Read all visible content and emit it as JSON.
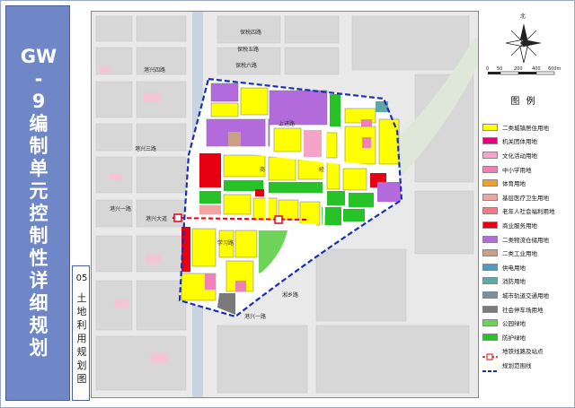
{
  "title": {
    "lines": [
      "GW",
      "-",
      "9",
      "编",
      "制",
      "单",
      "元",
      "控",
      "制",
      "性",
      "详",
      "细",
      "规",
      "划"
    ]
  },
  "sheet": {
    "number": "05",
    "name_chars": [
      "土",
      "地",
      "利",
      "用",
      "规",
      "划",
      "图"
    ]
  },
  "compass": {
    "north_label": "北",
    "scale_ticks": [
      "0",
      "50",
      "200",
      "400",
      "600m"
    ]
  },
  "legend": {
    "title": "图 例",
    "items": [
      {
        "label": "二类城镇居住用地",
        "color": "#ffff00",
        "kind": "fill"
      },
      {
        "label": "机关团体用地",
        "color": "#e6007e",
        "kind": "fill"
      },
      {
        "label": "文化活动用地",
        "color": "#f6a3c8",
        "kind": "fill"
      },
      {
        "label": "中小学用地",
        "color": "#f080b8",
        "kind": "fill"
      },
      {
        "label": "体育用地",
        "color": "#f0a030",
        "kind": "fill"
      },
      {
        "label": "基层医疗卫生用地",
        "color": "#f4a3a3",
        "kind": "fill"
      },
      {
        "label": "老年人社会福利用地",
        "color": "#f27b8a",
        "kind": "fill"
      },
      {
        "label": "商业服务用地",
        "color": "#e60012",
        "kind": "fill"
      },
      {
        "label": "二类物流仓储用地",
        "color": "#b36bdc",
        "kind": "fill"
      },
      {
        "label": "二类工业用地",
        "color": "#c9a088",
        "kind": "fill"
      },
      {
        "label": "供电用地",
        "color": "#4f9bc4",
        "kind": "fill"
      },
      {
        "label": "消防用地",
        "color": "#5fa8a8",
        "kind": "fill"
      },
      {
        "label": "城市轨道交通用地",
        "color": "#7d8f9e",
        "kind": "fill"
      },
      {
        "label": "社会停车场用地",
        "color": "#7a7a7a",
        "kind": "fill"
      },
      {
        "label": "公园绿地",
        "color": "#6fd35a",
        "kind": "fill"
      },
      {
        "label": "防护绿地",
        "color": "#27c227",
        "kind": "fill"
      },
      {
        "label": "地铁线路及站点",
        "color": "#e60012",
        "kind": "metro"
      },
      {
        "label": "规划范围线",
        "color": "#1a2fb5",
        "kind": "dash"
      }
    ]
  },
  "map": {
    "road_labels": [
      {
        "name": "保税四路",
        "id": "r1"
      },
      {
        "name": "保税五路",
        "id": "r2"
      },
      {
        "name": "保税六路",
        "id": "r3"
      },
      {
        "name": "港兴四路",
        "id": "r4"
      },
      {
        "name": "港兴三路",
        "id": "r5"
      },
      {
        "name": "港兴一路",
        "id": "r6"
      },
      {
        "name": "港兴一路",
        "id": "r7"
      },
      {
        "name": "上进路",
        "id": "r8"
      },
      {
        "name": "商",
        "id": "r9"
      },
      {
        "name": "经",
        "id": "r10"
      },
      {
        "name": "港兴大道",
        "id": "r11"
      },
      {
        "name": "学习路",
        "id": "r12"
      },
      {
        "name": "湘乡路",
        "id": "r13"
      }
    ]
  }
}
